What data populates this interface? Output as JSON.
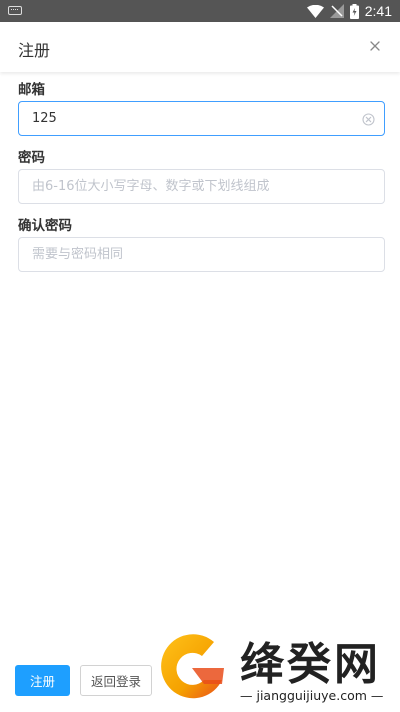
{
  "status_bar": {
    "time": "2:41",
    "icons": [
      "keyboard-icon",
      "wifi-icon",
      "signal-icon",
      "battery-charging-icon"
    ]
  },
  "header": {
    "title": "注册",
    "close_icon": "close-icon"
  },
  "form": {
    "email": {
      "label": "邮箱",
      "value": "125",
      "clear_icon": "clear-circle-icon"
    },
    "password": {
      "label": "密码",
      "placeholder": "由6-16位大小写字母、数字或下划线组成"
    },
    "confirm_password": {
      "label": "确认密码",
      "placeholder": "需要与密码相同"
    }
  },
  "actions": {
    "register_label": "注册",
    "back_to_login_label": "返回登录"
  },
  "watermark": {
    "text": "绛癸网",
    "url": "jiangguijiuye.com",
    "colors": {
      "ring": "#f5a100",
      "ring_dark": "#e94e1b"
    }
  },
  "colors": {
    "primary": "#1e9fff",
    "focus_border": "#409eff",
    "status_bar": "#555555"
  }
}
